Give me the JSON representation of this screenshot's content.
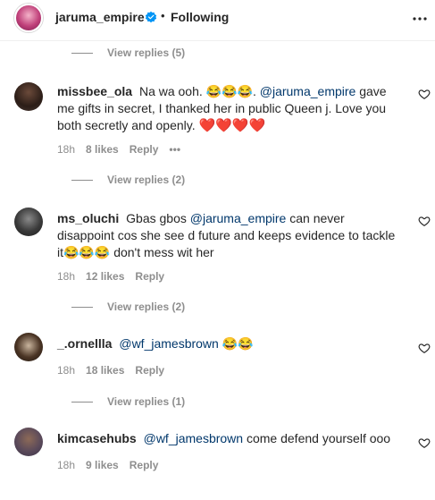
{
  "header": {
    "username": "jaruma_empire",
    "separator": "•",
    "follow_status": "Following"
  },
  "view_replies": [
    "View replies (5)",
    "View replies (2)",
    "View replies (2)",
    "View replies (1)"
  ],
  "comments": [
    {
      "username": "missbee_ola",
      "text_1": "Na wa ooh.",
      "emoji_1": "😂😂😂",
      "text_2": ".",
      "mention": "@jaruma_empire",
      "text_3": "gave me gifts in secret, I thanked her in public Queen j. Love you both secretly and openly.",
      "hearts": "❤️❤️❤️❤️",
      "time": "18h",
      "likes": "8 likes",
      "reply": "Reply",
      "more": "•••"
    },
    {
      "username": "ms_oluchi",
      "text_1": "Gbas gbos",
      "mention": "@jaruma_empire",
      "text_2": "can never disappoint cos she see d future and keeps evidence to tackle it",
      "emoji_1": "😂😂😂",
      "text_3": "don't mess wit her",
      "time": "18h",
      "likes": "12 likes",
      "reply": "Reply"
    },
    {
      "username": "_.ornellla",
      "mention": "@wf_jamesbrown",
      "emoji_1": "😂😂",
      "time": "18h",
      "likes": "18 likes",
      "reply": "Reply"
    },
    {
      "username": "kimcasehubs",
      "mention": "@wf_jamesbrown",
      "text_1": "come defend yourself ooo",
      "time": "18h",
      "likes": "9 likes",
      "reply": "Reply"
    }
  ],
  "colors": {
    "text": "#262626",
    "secondary": "#8e8e8e",
    "mention": "#00376b",
    "verified": "#0095f6",
    "heart": "#ed4956"
  },
  "icons": [
    "verified-badge-icon",
    "more-options-icon",
    "like-heart-icon"
  ]
}
